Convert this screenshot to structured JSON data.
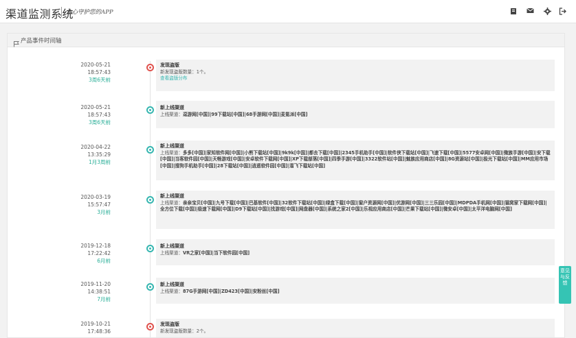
{
  "header": {
    "brand": "渠道监测系统",
    "slogan": "全心守护您的APP",
    "icons": [
      "document-icon",
      "mail-icon",
      "gear-icon",
      "logout-icon"
    ]
  },
  "panel": {
    "title": "产品事件时间轴"
  },
  "events": [
    {
      "date": "2020-05-21",
      "time": "18:57:43",
      "ago": "3周6天前",
      "type": "red",
      "title": "发现盗版",
      "label": "新发现盗版数量：",
      "text": "1个。",
      "link": "查看盗版分布"
    },
    {
      "date": "2020-05-21",
      "time": "18:57:43",
      "ago": "3周6天前",
      "type": "teal",
      "title": "新上线渠道",
      "label": "上线渠道：",
      "text": "逗游网[中国]|99下载站[中国]|68手游网[中国]|麦氪派[中国]",
      "link": ""
    },
    {
      "date": "2020-04-22",
      "time": "13:35:29",
      "ago": "1月3周前",
      "type": "teal",
      "title": "新上线渠道",
      "label": "上线渠道：",
      "text": "多多[中国]|家知软件网[中国]|小熊下载站[中国]|9k9k[中国]|都去下载[中国]|2345手机助手[中国]|软件侠下载站[中国]|飞速下载[中国]|5577安卓网[中国]|微族手游[中国]|安下载[中国]|当客软件园[中国]|天畅游戏[中国]|安卓软件下载网[中国]|XP下载部落[中国]|四季手游[中国]|3322软件站[中国]|魅族应用商店[中国]|8G资源站[中国]|极光下载站[中国]|MM应用市场[中国]|搜狗手机助手[中国]|28下载站[中国]|逍遥软件园[中国]|溜飞下载站[中国]",
      "link": ""
    },
    {
      "date": "2020-03-19",
      "time": "15:57:47",
      "ago": "3月前",
      "type": "teal",
      "title": "新上线渠道",
      "label": "上线渠道：",
      "text": "亲亲宝贝[中国]|九号下载[中国]|巴基软件[中国]|32软件下载站[中国]|绿盒下载[中国]|窗户资源网[中国]|优游网[中国]|三三乐园[中国]|MDPDA手机网[中国]|猫窝家下载网[中国]|全方位下载[中国]|极速下载网[中国]|D9下载站[中国]|找游戏[中国]|网盘器[中国]|系统之家2[中国]|乐视应用商店[中国]|芒果下载站[中国]|微安卓[中国]|太平洋电脑网[中国]",
      "link": ""
    },
    {
      "date": "2019-12-18",
      "time": "17:22:42",
      "ago": "6月前",
      "type": "teal",
      "title": "新上线渠道",
      "label": "上线渠道：",
      "text": "VR之家[中国]|当下软件园[中国]",
      "link": ""
    },
    {
      "date": "2019-11-20",
      "time": "14:38:51",
      "ago": "7月前",
      "type": "teal",
      "title": "新上线渠道",
      "label": "上线渠道：",
      "text": "87G手游网[中国]|ZD423[中国]|安粉丝[中国]",
      "link": ""
    },
    {
      "date": "2019-10-21",
      "time": "17:48:36",
      "ago": "",
      "type": "red",
      "title": "发现盗版",
      "label": "新发现盗版数量：",
      "text": "2个。",
      "link": ""
    }
  ],
  "side_button": "意见与反馈",
  "colors": {
    "accent": "#35b6b0",
    "alert": "#e0524d",
    "feedback": "#35c4b4"
  }
}
